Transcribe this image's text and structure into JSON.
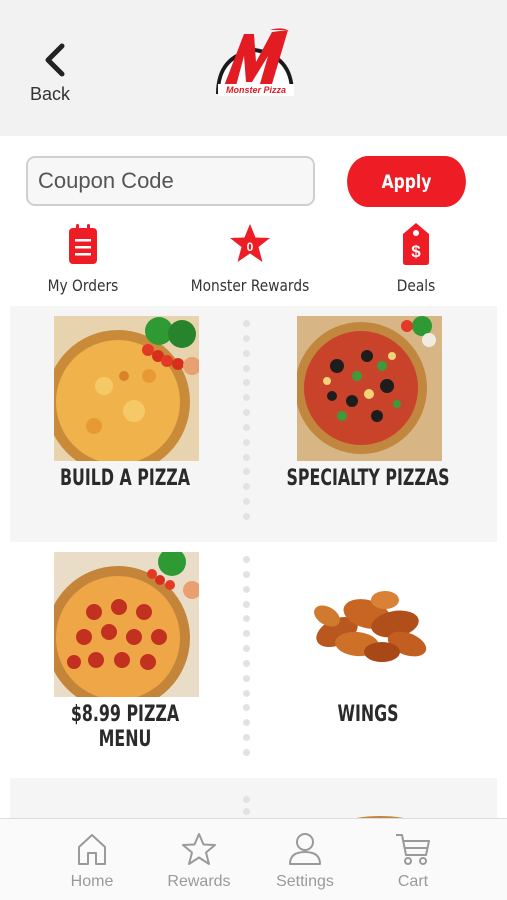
{
  "header": {
    "back_label": "Back",
    "logo_text": "Monster Pizza"
  },
  "coupon": {
    "placeholder": "Coupon Code",
    "value": "",
    "apply_label": "Apply"
  },
  "quick_links": {
    "orders_label": "My Orders",
    "rewards_label": "Monster Rewards",
    "rewards_count": "0",
    "deals_label": "Deals"
  },
  "menu": {
    "items": [
      {
        "label": "BUILD A PIZZA"
      },
      {
        "label": "SPECIALTY PIZZAS"
      },
      {
        "label": "$8.99 PIZZA MENU"
      },
      {
        "label": "WINGS"
      }
    ]
  },
  "tabbar": {
    "home_label": "Home",
    "rewards_label": "Rewards",
    "settings_label": "Settings",
    "cart_label": "Cart"
  },
  "colors": {
    "brand_red": "#ee1c25",
    "tab_gray": "#9a9a9a"
  }
}
